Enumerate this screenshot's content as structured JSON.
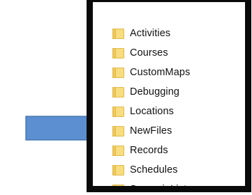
{
  "explorer": {
    "folder_icon_fill": "#f7dd80",
    "folder_icon_edge": "#e1b94a",
    "items": [
      {
        "label": "Activities"
      },
      {
        "label": "Courses"
      },
      {
        "label": "CustomMaps"
      },
      {
        "label": "Debugging"
      },
      {
        "label": "Locations"
      },
      {
        "label": "NewFiles"
      },
      {
        "label": "Records"
      },
      {
        "label": "Schedules"
      },
      {
        "label": "ScenarioLists"
      }
    ]
  },
  "annotation": {
    "arrow_icon": "right-arrow-icon",
    "arrow_fill": "#5b8fd1",
    "arrow_stroke": "#3e6da9"
  }
}
